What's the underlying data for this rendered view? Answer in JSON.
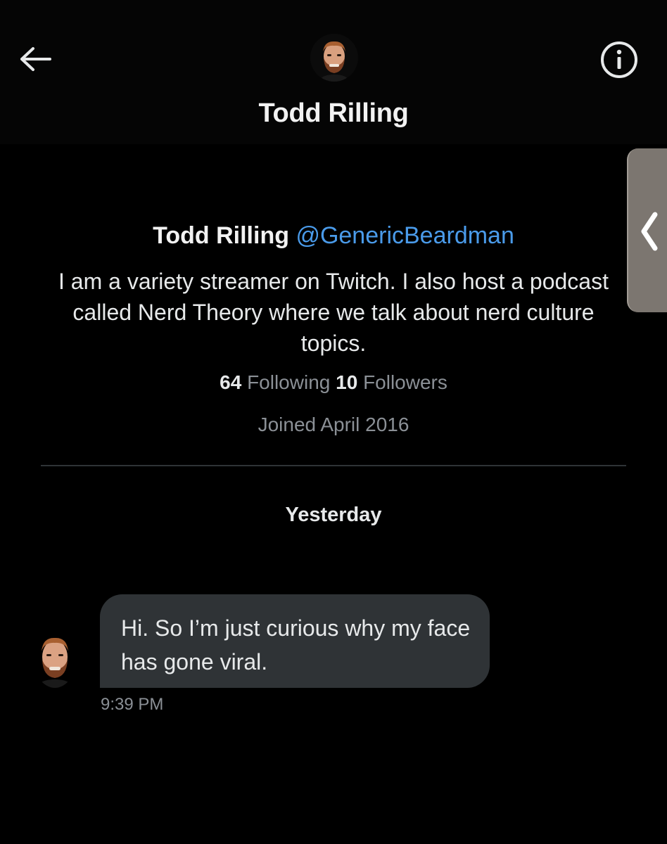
{
  "header": {
    "back_icon": "arrow-left-icon",
    "title": "Todd Rilling",
    "info_icon": "info-icon"
  },
  "side_tab": {
    "icon": "chevron-left-icon"
  },
  "profile": {
    "name": "Todd Rilling",
    "handle": "@GenericBeardman",
    "bio": "I am a variety streamer on Twitch. I also host a podcast called Nerd Theory where we talk about nerd culture topics.",
    "following_count": "64",
    "following_label": "Following",
    "followers_count": "10",
    "followers_label": "Followers",
    "joined": "Joined April 2016"
  },
  "conversation": {
    "day_label": "Yesterday",
    "messages": [
      {
        "text": "Hi. So I’m just curious why my face has gone viral.",
        "time": "9:39 PM"
      }
    ]
  },
  "colors": {
    "background": "#000000",
    "accent": "#4a9bea",
    "bubble": "#2f3336",
    "muted": "#8b9096"
  }
}
